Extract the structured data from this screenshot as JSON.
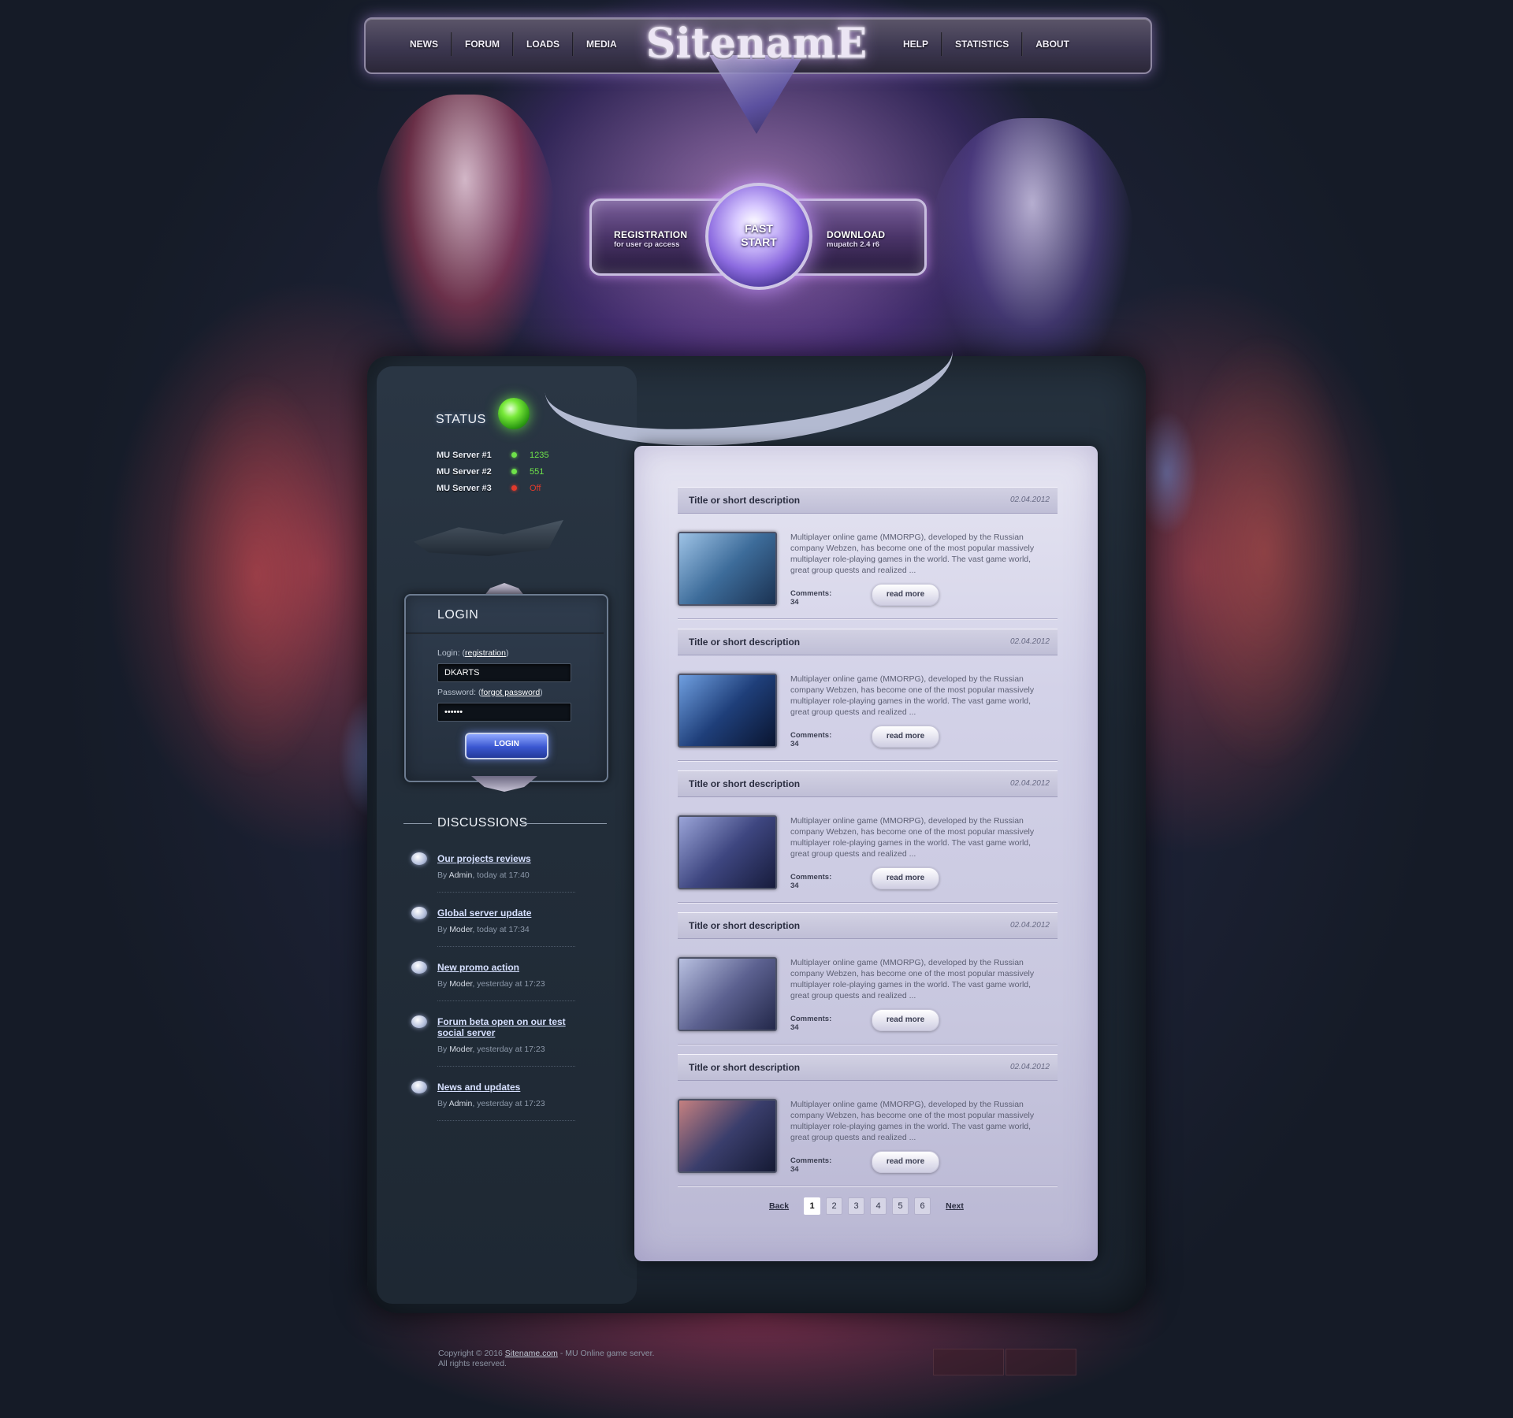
{
  "header": {
    "logo": "SitenamE",
    "nav_left": [
      "NEWS",
      "FORUM",
      "LOADS",
      "MEDIA"
    ],
    "nav_right": [
      "HELP",
      "STATISTICS",
      "ABOUT"
    ]
  },
  "fast_start": {
    "registration_title": "REGISTRATION",
    "registration_sub": "for user cp access",
    "orb_line1": "FAST",
    "orb_line2": "START",
    "download_title": "DOWNLOAD",
    "download_sub": "mupatch 2.4 r6"
  },
  "status": {
    "title": "STATUS",
    "servers": [
      {
        "name": "MU Server #1",
        "value": "1235",
        "state": "online",
        "color": "#6ee24a"
      },
      {
        "name": "MU Server #2",
        "value": "551",
        "state": "online",
        "color": "#6ee24a"
      },
      {
        "name": "MU Server #3",
        "value": "Off",
        "state": "offline",
        "color": "#e03a2c"
      }
    ]
  },
  "login": {
    "title": "LOGIN",
    "login_label": "Login:",
    "registration_link": "registration",
    "login_value": "DKARTS",
    "password_label": "Password:",
    "forgot_link": "forgot password",
    "password_value": "••••••",
    "button": "LOGIN"
  },
  "discussions": {
    "title": "DISCUSSIONS",
    "by": "By",
    "items": [
      {
        "title": "Our projects reviews",
        "author": "Admin",
        "time": "today at 17:40"
      },
      {
        "title": "Global server update",
        "author": "Moder",
        "time": "today at 17:34"
      },
      {
        "title": "New promo action",
        "author": "Moder",
        "time": "yesterday at 17:23"
      },
      {
        "title": "Forum beta open on our test social server",
        "author": "Moder",
        "time": "yesterday at 17:23"
      },
      {
        "title": "News and updates",
        "author": "Admin",
        "time": "yesterday at 17:23"
      }
    ]
  },
  "posts": [
    {
      "title": "Title or short description",
      "date": "02.04.2012",
      "text": "Multiplayer online game (MMORPG), developed by the Russian company Webzen, has become one of the most popular massively multiplayer role-playing games in the world. The vast game world, great group quests and realized ...",
      "comments": "Comments: 34",
      "button": "read more",
      "thumb": [
        "#9ec3e6",
        "#3d6c9a",
        "#1b3252"
      ]
    },
    {
      "title": "Title or short description",
      "date": "02.04.2012",
      "text": "Multiplayer online game (MMORPG), developed by the Russian company Webzen, has become one of the most popular massively multiplayer role-playing games in the world. The vast game world, great group quests and realized ...",
      "comments": "Comments: 34",
      "button": "read more",
      "thumb": [
        "#6f9fe0",
        "#1f3f7a",
        "#0a1530"
      ]
    },
    {
      "title": "Title or short description",
      "date": "02.04.2012",
      "text": "Multiplayer online game (MMORPG), developed by the Russian company Webzen, has become one of the most popular massively multiplayer role-playing games in the world. The vast game world, great group quests and realized ...",
      "comments": "Comments: 34",
      "button": "read more",
      "thumb": [
        "#9aa4d8",
        "#3e4680",
        "#171c3c"
      ]
    },
    {
      "title": "Title or short description",
      "date": "02.04.2012",
      "text": "Multiplayer online game (MMORPG), developed by the Russian company Webzen, has become one of the most popular massively multiplayer role-playing games in the world. The vast game world, great group quests and realized ...",
      "comments": "Comments: 34",
      "button": "read more",
      "thumb": [
        "#b8c0e0",
        "#5c6190",
        "#23284a"
      ]
    },
    {
      "title": "Title or short description",
      "date": "02.04.2012",
      "text": "Multiplayer online game (MMORPG), developed by the Russian company Webzen, has become one of the most popular massively multiplayer role-playing games in the world. The vast game world, great group quests and realized ...",
      "comments": "Comments: 34",
      "button": "read more",
      "thumb": [
        "#c58080",
        "#3a3e6c",
        "#151a34"
      ]
    }
  ],
  "pagination": {
    "back": "Back",
    "pages": [
      "1",
      "2",
      "3",
      "4",
      "5",
      "6"
    ],
    "active": "1",
    "next": "Next"
  },
  "footer": {
    "copyright_prefix": "Copyright © 2016",
    "site_link": "Sitename.com",
    "copyright_suffix": "- MU Online game server.",
    "rights": "All rights reserved."
  }
}
